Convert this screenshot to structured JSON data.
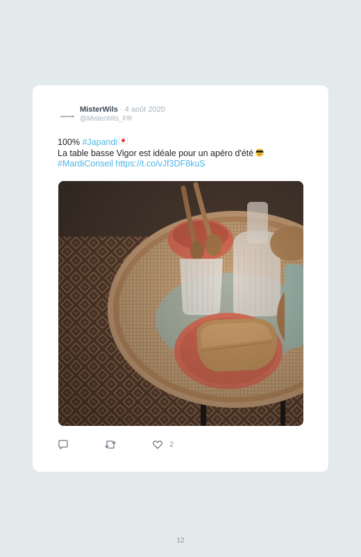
{
  "tweet": {
    "avatar_text": "misterwils",
    "display_name": "MisterWils",
    "separator": " · ",
    "date": "4 août 2020",
    "handle": "@MisterWils_FR",
    "text_line1": "100%",
    "hashtag_japandi": "#Japandi",
    "flag_emoji": "japan-flag",
    "text_line2": "La table basse Vigor est idéale pour un apéro d'été",
    "cool_emoji": "smiling-face-with-sunglasses",
    "hashtag_mardi": "#MardiConseil",
    "link": "https://t.co/vJf3DF8kuS",
    "like_count": "2"
  },
  "icons": {
    "reply": "reply-icon",
    "retweet": "retweet-icon",
    "like": "heart-icon"
  },
  "colors": {
    "link": "#4db6e8",
    "background": "#e3eaec",
    "card": "#ffffff"
  },
  "page": {
    "number": "12"
  }
}
